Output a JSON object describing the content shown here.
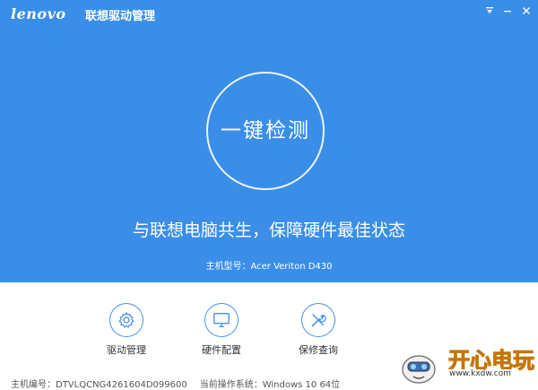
{
  "titlebar": {
    "logo": "lenovo",
    "app_title": "联想驱动管理"
  },
  "hero": {
    "scan_button_label": "一键检测",
    "slogan": "与联想电脑共生，保障硬件最佳状态",
    "model_label": "主机型号：",
    "model_value": "Acer Veriton D430"
  },
  "tools": [
    {
      "label": "驱动管理",
      "icon": "gear-icon"
    },
    {
      "label": "硬件配置",
      "icon": "monitor-icon"
    },
    {
      "label": "保修查询",
      "icon": "tools-icon"
    }
  ],
  "status": {
    "serial_label": "主机编号：",
    "serial_value": "DTVLQCNG4261604D099600",
    "os_label": "当前操作系统：",
    "os_value": "Windows 10 64位"
  },
  "watermark": {
    "brand": "开心电玩",
    "url": "www.kxdw.com"
  },
  "colors": {
    "hero_bg": "#3a8ee8",
    "accent": "#4a90e2"
  }
}
